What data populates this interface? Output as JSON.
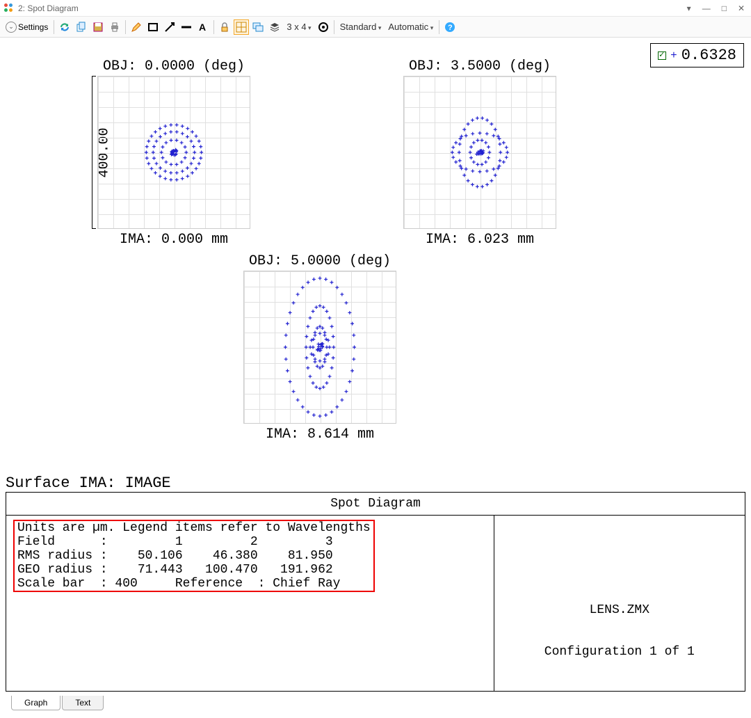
{
  "window": {
    "title": "2: Spot Diagram"
  },
  "toolbar": {
    "settings_label": "Settings",
    "grid_label": "3 x 4",
    "mode1": "Standard",
    "mode2": "Automatic"
  },
  "legend": {
    "wavelength": "0.6328"
  },
  "yscale_label": "400.00",
  "spots": [
    {
      "title": "OBJ: 0.0000 (deg)",
      "bottom": "IMA: 0.000 mm"
    },
    {
      "title": "OBJ: 3.5000 (deg)",
      "bottom": "IMA: 6.023 mm"
    },
    {
      "title": "OBJ: 5.0000 (deg)",
      "bottom": "IMA: 8.614 mm"
    }
  ],
  "surface_label": "Surface IMA: IMAGE",
  "table": {
    "header": "Spot Diagram",
    "left_text": "Units are µm. Legend items refer to Wavelengths\nField      :         1         2         3\nRMS radius :    50.106    46.380    81.950\nGEO radius :    71.443   100.470   191.962\nScale bar  : 400     Reference  : Chief Ray",
    "right_filename": "LENS.ZMX",
    "right_config": "Configuration 1 of 1"
  },
  "tabs": {
    "graph": "Graph",
    "text": "Text"
  },
  "chart_data": {
    "type": "table",
    "title": "Spot Diagram",
    "units": "µm",
    "legend_note": "Legend items refer to Wavelengths",
    "fields": [
      1,
      2,
      3
    ],
    "field_angles_deg": [
      0.0,
      3.5,
      5.0
    ],
    "image_positions_mm": [
      0.0,
      6.023,
      8.614
    ],
    "rms_radius": [
      50.106,
      46.38,
      81.95
    ],
    "geo_radius": [
      71.443,
      100.47,
      191.962
    ],
    "scale_bar": 400,
    "reference": "Chief Ray",
    "wavelength_um": 0.6328,
    "lens_file": "LENS.ZMX",
    "configuration": "1 of 1"
  }
}
